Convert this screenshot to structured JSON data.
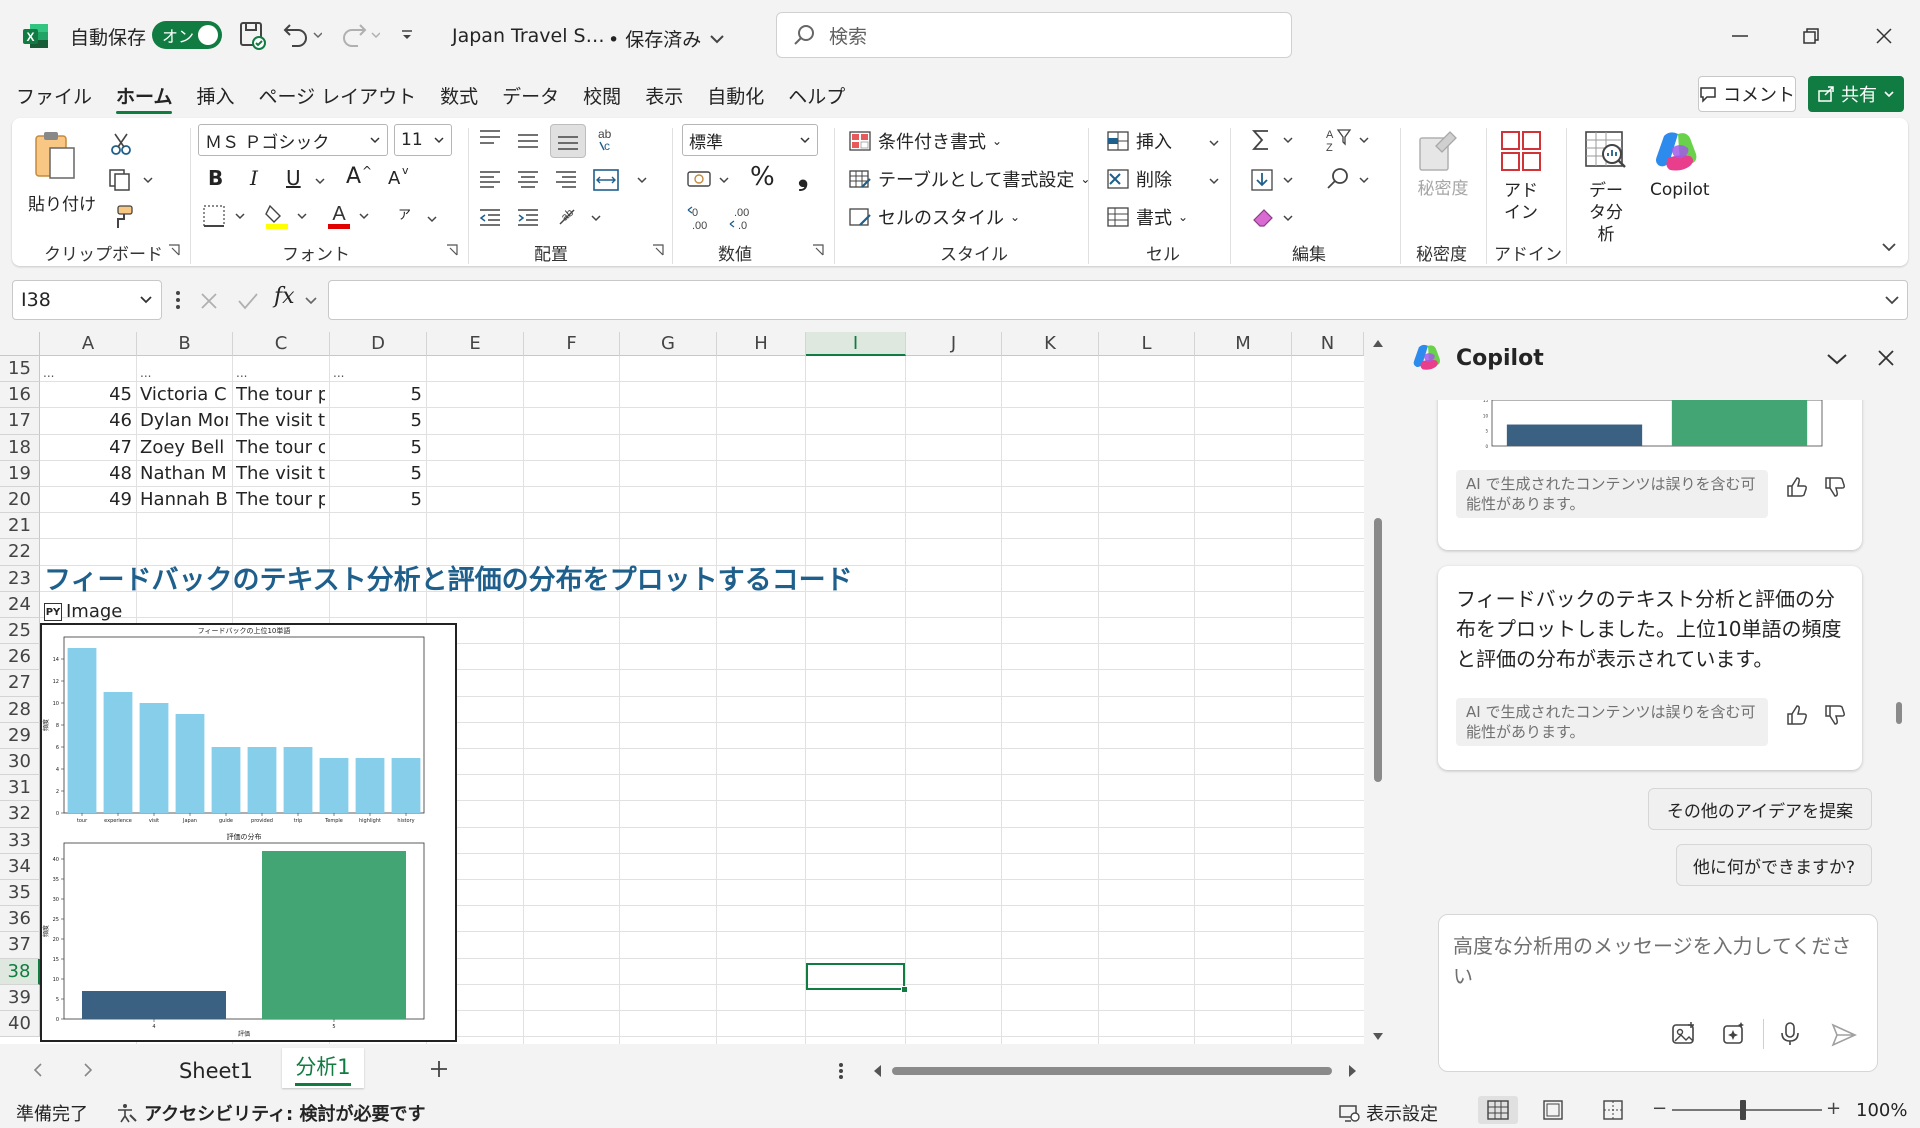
{
  "title_bar": {
    "autosave_label": "自動保存",
    "autosave_state": "オン",
    "doc_title": "Japan Travel S…",
    "save_status": "• 保存済み",
    "search_placeholder": "検索"
  },
  "menu": {
    "tabs": [
      "ファイル",
      "ホーム",
      "挿入",
      "ページ レイアウト",
      "数式",
      "データ",
      "校閲",
      "表示",
      "自動化",
      "ヘルプ"
    ],
    "active": "ホーム",
    "comment_label": "コメント",
    "share_label": "共有"
  },
  "ribbon": {
    "clipboard": {
      "label": "クリップボード",
      "paste": "貼り付け"
    },
    "font": {
      "label": "フォント",
      "font_name": "ＭＳ Ｐゴシック",
      "font_size": "11",
      "bold": "B",
      "italic": "I",
      "underline": "U",
      "grow": "A",
      "shrink": "A",
      "phonetic": "ア"
    },
    "alignment": {
      "label": "配置"
    },
    "number": {
      "label": "数値",
      "format": "標準",
      "percent": "%",
      "comma": "❟"
    },
    "styles": {
      "label": "スタイル",
      "conditional": "条件付き書式",
      "table": "テーブルとして書式設定",
      "cell_style": "セルのスタイル"
    },
    "cells": {
      "label": "セル",
      "insert": "挿入",
      "delete": "削除",
      "format": "書式"
    },
    "editing": {
      "label": "編集"
    },
    "sensitivity": {
      "label": "秘密度",
      "button": "秘密度"
    },
    "addins": {
      "label": "アドイン",
      "button": "アドイン"
    },
    "data_analysis": "データ分析",
    "copilot": "Copilot"
  },
  "formula_bar": {
    "name_box": "I38",
    "formula": ""
  },
  "sheet": {
    "columns": [
      "A",
      "B",
      "C",
      "D",
      "E",
      "F",
      "G",
      "H",
      "I",
      "J",
      "K",
      "L",
      "M",
      "N"
    ],
    "rows": [
      "15",
      "16",
      "17",
      "18",
      "19",
      "20",
      "21",
      "22",
      "23",
      "24",
      "25",
      "26",
      "27",
      "28",
      "29",
      "30",
      "31",
      "32",
      "33",
      "34",
      "35",
      "36",
      "37",
      "38",
      "39",
      "40"
    ],
    "data_rows": [
      {
        "a": "...",
        "b": "...",
        "c": "...",
        "d": "..."
      },
      {
        "a": "45",
        "b": "Victoria C",
        "c": "The tour p",
        "d": "5"
      },
      {
        "a": "46",
        "b": "Dylan Mor",
        "c": "The visit t",
        "d": "5"
      },
      {
        "a": "47",
        "b": "Zoey Bell",
        "c": "The tour c",
        "d": "5"
      },
      {
        "a": "48",
        "b": "Nathan Mu",
        "c": "The visit t",
        "d": "5"
      },
      {
        "a": "49",
        "b": "Hannah Ba",
        "c": "The tour p",
        "d": "5"
      }
    ],
    "heading": "フィードバックのテキスト分析と評価の分布をプロットするコード",
    "py_badge": "PY",
    "image_label": "Image"
  },
  "chart_data": [
    {
      "type": "bar",
      "title": "フィードバックの上位10単語",
      "xlabel": "",
      "ylabel": "頻度",
      "categories": [
        "tour",
        "experience",
        "visit",
        "Japan",
        "guide",
        "provided",
        "trip",
        "Temple",
        "highlight",
        "history"
      ],
      "values": [
        15,
        11,
        10,
        9,
        6,
        6,
        6,
        5,
        5,
        5
      ],
      "ylim": [
        0,
        16
      ],
      "yticks": [
        0,
        2,
        4,
        6,
        8,
        10,
        12,
        14
      ],
      "color": "#87ceeb",
      "grid": false
    },
    {
      "type": "bar",
      "title": "評価の分布",
      "xlabel": "評価",
      "ylabel": "頻度",
      "categories": [
        "4",
        "5"
      ],
      "values": [
        7,
        42
      ],
      "ylim": [
        0,
        44
      ],
      "yticks": [
        0,
        5,
        10,
        15,
        20,
        25,
        30,
        35,
        40
      ],
      "colors": [
        "#3a6181",
        "#44a574"
      ],
      "grid": false
    }
  ],
  "sheet_tabs": {
    "tabs": [
      "Sheet1",
      "分析1"
    ],
    "active": "分析1"
  },
  "status_bar": {
    "ready": "準備完了",
    "accessibility": "アクセシビリティ: 検討が必要です",
    "display_settings": "表示設定",
    "zoom": "100%"
  },
  "copilot": {
    "title": "Copilot",
    "ai_notice": "AI で生成されたコンテンツは誤りを含む可能性があります。",
    "message": "フィードバックのテキスト分析と評価の分布をプロットしました。上位10単語の頻度と評価の分布が表示されています。",
    "suggestions": [
      "その他のアイデアを提案",
      "他に何ができますか?"
    ],
    "input_placeholder": "高度な分析用のメッセージを入力してください",
    "preview_chart": {
      "values": [
        7,
        42
      ],
      "colors": [
        "#3a6181",
        "#44a574"
      ],
      "yticks": [
        0,
        5,
        10,
        15
      ]
    }
  },
  "colors": {
    "excel_green": "#107c41",
    "heading_blue": "#1e5f8c",
    "selection_green": "#107c41"
  }
}
